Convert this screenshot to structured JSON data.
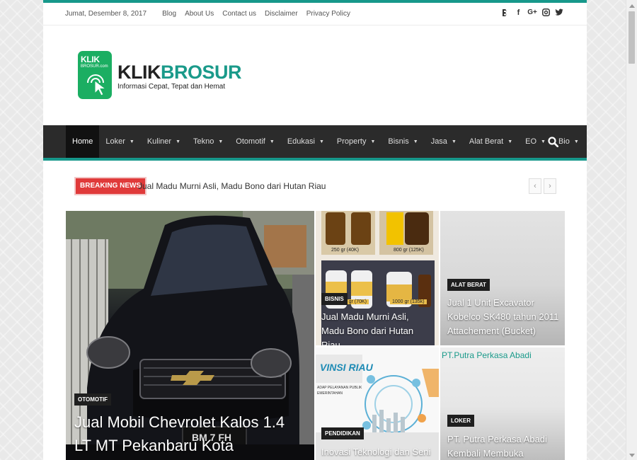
{
  "topbar": {
    "date": "Jumat, Desember 8, 2017",
    "links": [
      "Blog",
      "About Us",
      "Contact us",
      "Disclaimer",
      "Privacy Policy"
    ],
    "social_icons": [
      "blogger-icon",
      "facebook-icon",
      "google-plus-icon",
      "instagram-icon",
      "twitter-icon"
    ]
  },
  "logo": {
    "badge_line1": "KLIK",
    "badge_line2": "BROSUR.com",
    "name_part1": "KLIK",
    "name_part2": "BROSUR",
    "tagline": "Informasi Cepat, Tepat dan Hemat"
  },
  "nav": {
    "items": [
      {
        "label": "Home",
        "active": true,
        "has_dropdown": false
      },
      {
        "label": "Loker",
        "has_dropdown": true
      },
      {
        "label": "Kuliner",
        "has_dropdown": true
      },
      {
        "label": "Tekno",
        "has_dropdown": true
      },
      {
        "label": "Otomotif",
        "has_dropdown": true
      },
      {
        "label": "Edukasi",
        "has_dropdown": true
      },
      {
        "label": "Property",
        "has_dropdown": true
      },
      {
        "label": "Bisnis",
        "has_dropdown": true
      },
      {
        "label": "Jasa",
        "has_dropdown": true
      },
      {
        "label": "Alat Berat",
        "has_dropdown": true
      },
      {
        "label": "EO",
        "has_dropdown": true
      },
      {
        "label": "Bio",
        "has_dropdown": true
      }
    ],
    "caret": "▼"
  },
  "breaking": {
    "label": "BREAKING NEWS",
    "headline": "Jual Madu Murni Asli, Madu Bono dari Hutan Riau",
    "prev": "‹",
    "next": "›"
  },
  "slider": {
    "big": {
      "category": "OTOMOTIF",
      "title": "Jual Mobil Chevrolet Kalos 1.4 LT MT Pekanbaru Kota"
    },
    "madu": {
      "category": "BISNIS",
      "title": "Jual Madu Murni Asli, Madu Bono dari Hutan Riau",
      "labels": [
        "250 gr (40K)",
        "800 gr (125K)",
        "500 gr (70K)",
        "1000 gr (135k)"
      ]
    },
    "excavator": {
      "category": "ALAT BERAT",
      "title": "Jual 1 Unit Excavator Kobelco SK480 tahun 2011 Attachement (Bucket)"
    },
    "inovasi": {
      "category": "PENDIDIKAN",
      "title": "Inovasi Teknologi dan Seni",
      "img_text1": "VINSI RIAU",
      "img_text2": "ADAP PELAYANAN PUBLIK",
      "img_text3": "EMERINTAHAN"
    },
    "putra": {
      "category": "LOKER",
      "caption": "PT.Putra Perkasa Abadi",
      "title": "PT. Putra Perkasa Abadi Kembali Membuka Lowongan Kerja,"
    }
  },
  "colors": {
    "accent": "#17988b",
    "nav_bg": "#2b2b2b",
    "breaking_red": "#e03a3a",
    "logo_green": "#1bae62"
  }
}
